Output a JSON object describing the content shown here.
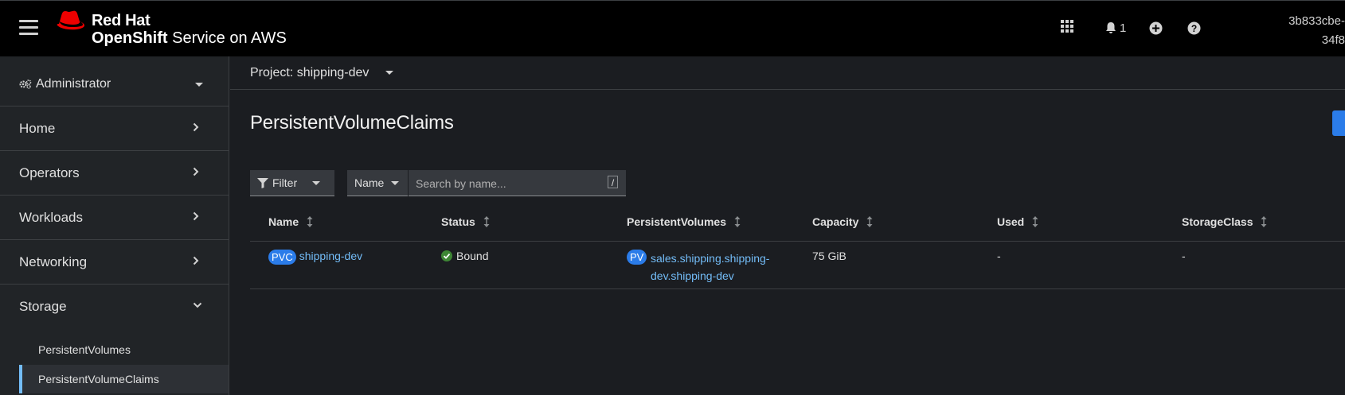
{
  "masthead": {
    "brand_line1": "Red Hat",
    "brand_line2_bold": "OpenShift",
    "brand_line2_rest": " Service on AWS",
    "notification_count": "1",
    "user_line1": "3b833cbe-",
    "user_line2": "34f8"
  },
  "sidebar": {
    "perspective": "Administrator",
    "items": [
      {
        "label": "Home"
      },
      {
        "label": "Operators"
      },
      {
        "label": "Workloads"
      },
      {
        "label": "Networking"
      }
    ],
    "storage": {
      "label": "Storage",
      "children": [
        {
          "label": "PersistentVolumes"
        },
        {
          "label": "PersistentVolumeClaims"
        }
      ]
    }
  },
  "main": {
    "project": "Project: shipping-dev",
    "title": "PersistentVolumeClaims",
    "filter_label": "Filter",
    "name_select": "Name",
    "search_placeholder": "Search by name...",
    "search_shortcut": "/",
    "columns": [
      "Name",
      "Status",
      "PersistentVolumes",
      "Capacity",
      "Used",
      "StorageClass"
    ],
    "rows": [
      {
        "kind_badge": "PVC",
        "name": "shipping-dev",
        "status": "Bound",
        "pv_badge": "PV",
        "pv_name": "sales.shipping.shipping-dev.shipping-dev",
        "capacity": "75 GiB",
        "used": "-",
        "storage_class": "-"
      }
    ]
  },
  "colors": {
    "accent_blue": "#2b7ce9",
    "link_blue": "#73bcf7",
    "success_green": "#3e8635",
    "brand_red": "#ee0000"
  }
}
